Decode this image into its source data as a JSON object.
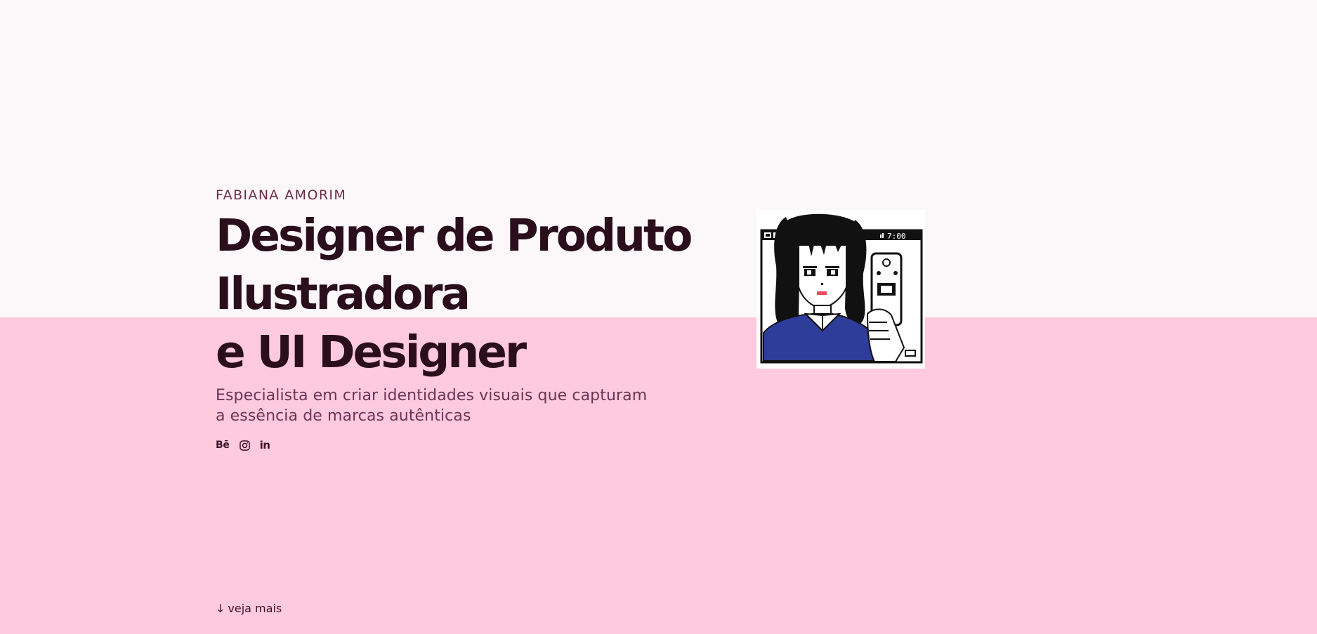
{
  "hero": {
    "name": "FABIANA AMORIM",
    "headline": [
      "Designer de Produto",
      "Ilustradora",
      "e UI Designer"
    ],
    "subtitle": [
      "Especialista em criar identidades visuais que capturam",
      "a essência de marcas autênticas"
    ],
    "social": {
      "behance": "Bē",
      "instagram_icon": "instagram-icon",
      "linkedin": "in"
    }
  },
  "scroll_hint": {
    "arrow": "↓",
    "label": "veja mais"
  },
  "illustration": {
    "phone_time": "7:00"
  },
  "colors": {
    "top_background": "#fcf7f8",
    "bottom_background": "#ffc9de",
    "headline": "#2a0e1b",
    "accent_text": "#6b2a45",
    "shirt_blue": "#2e3d9a"
  }
}
